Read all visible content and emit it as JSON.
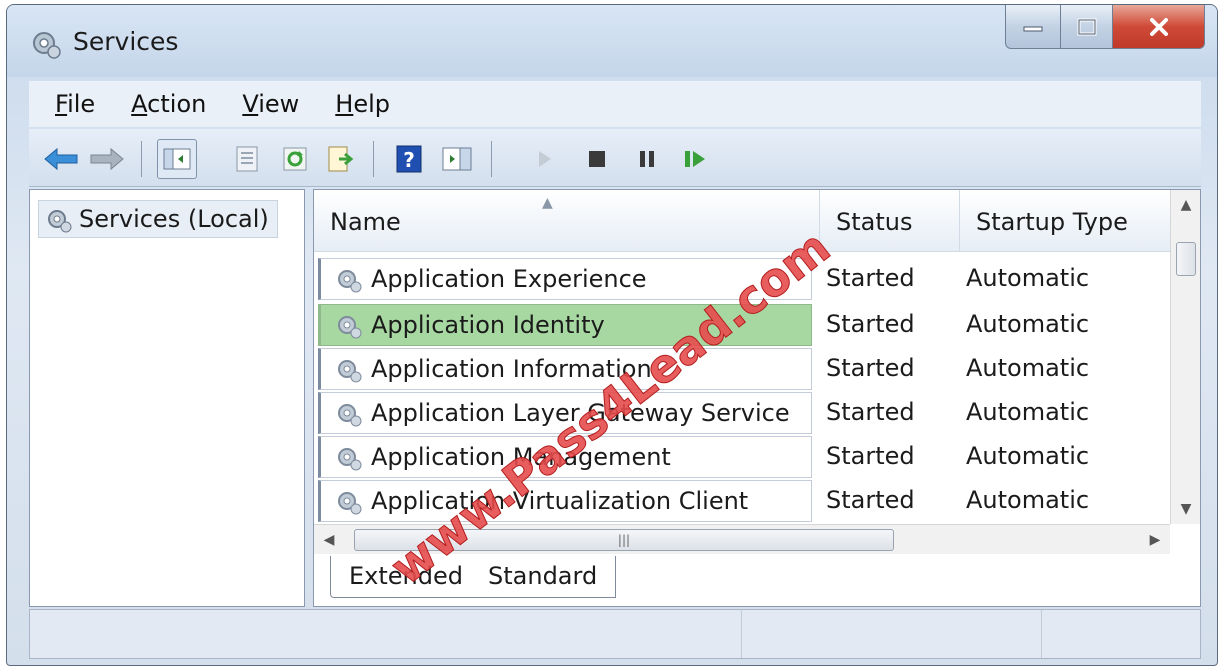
{
  "window": {
    "title": "Services",
    "icon": "services-gear-icon"
  },
  "titlebar_buttons": [
    "minimize-icon",
    "maximize-icon",
    "close-icon"
  ],
  "menu": [
    {
      "underline": "F",
      "rest": "ile"
    },
    {
      "underline": "A",
      "rest": "ction"
    },
    {
      "underline": "V",
      "rest": "iew"
    },
    {
      "underline": "H",
      "rest": "elp"
    }
  ],
  "toolbar": {
    "icons": [
      "back-arrow-icon",
      "forward-arrow-icon",
      "show-hide-console-tree-icon",
      "properties-icon",
      "refresh-icon",
      "export-list-icon",
      "help-icon",
      "show-action-pane-icon",
      "start-service-icon",
      "stop-service-icon",
      "pause-service-icon",
      "restart-service-icon"
    ]
  },
  "tree": {
    "root_label": "Services (Local)"
  },
  "list": {
    "columns": {
      "name": "Name",
      "status": "Status",
      "startup": "Startup Type"
    },
    "rows": [
      {
        "name": "Application Experience",
        "status": "Started",
        "startup": "Automatic"
      },
      {
        "name": "Application Identity",
        "status": "Started",
        "startup": "Automatic"
      },
      {
        "name": "Application Information",
        "status": "Started",
        "startup": "Automatic"
      },
      {
        "name": "Application Layer Gateway Service",
        "status": "Started",
        "startup": "Automatic"
      },
      {
        "name": "Application Management",
        "status": "Started",
        "startup": "Automatic"
      },
      {
        "name": "Application Virtualization Client",
        "status": "Started",
        "startup": "Automatic"
      }
    ],
    "selected_row": "Application Identity"
  },
  "tabs": [
    "Extended",
    "Standard"
  ],
  "watermark": "www.Pass4Lead.com",
  "colors": {
    "selection": "#a8d8a2",
    "titlebar": "#c5d6ea",
    "close_button": "#c0392b"
  }
}
